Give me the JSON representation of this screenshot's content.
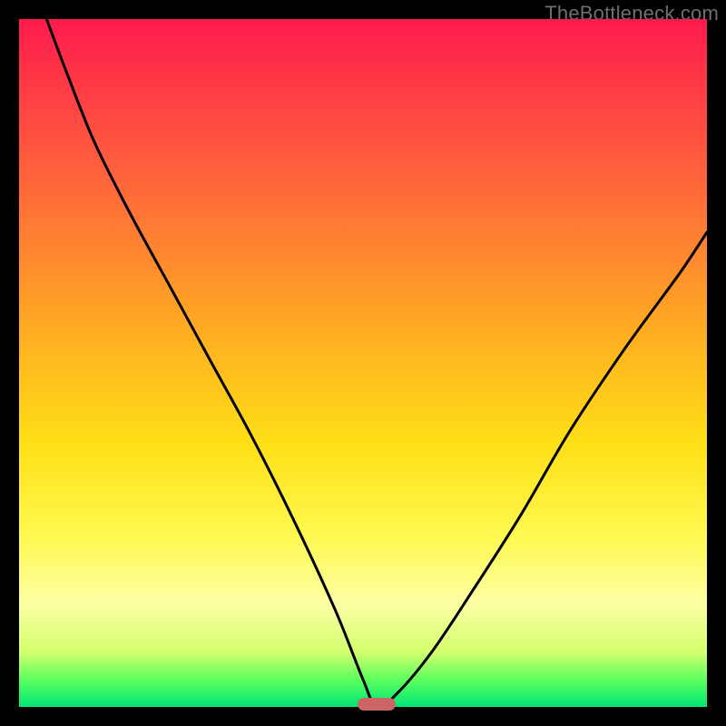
{
  "watermark": "TheBottleneck.com",
  "colors": {
    "frame": "#000000",
    "curve": "#000000",
    "marker": "#cc6666",
    "gradient_top": "#ff1a4d",
    "gradient_bottom": "#00e676"
  },
  "chart_data": {
    "type": "line",
    "title": "",
    "xlabel": "",
    "ylabel": "",
    "xlim": [
      0,
      100
    ],
    "ylim": [
      0,
      100
    ],
    "note": "Axes are unlabeled in the source image; x and y are normalized 0-100. Curve shows a V-shaped bottleneck dip reaching y≈0 near x≈52, with asymmetric arms.",
    "series": [
      {
        "name": "bottleneck-curve",
        "x": [
          4,
          7,
          11,
          16,
          22,
          28,
          34,
          40,
          46,
          50,
          52,
          55,
          60,
          66,
          73,
          80,
          88,
          96,
          100
        ],
        "values": [
          100,
          92,
          82,
          72,
          61,
          50,
          39,
          27,
          14,
          4,
          0,
          2,
          8,
          17,
          28,
          40,
          52,
          63,
          69
        ]
      }
    ],
    "marker": {
      "x": 52,
      "y": 0,
      "shape": "pill"
    }
  }
}
